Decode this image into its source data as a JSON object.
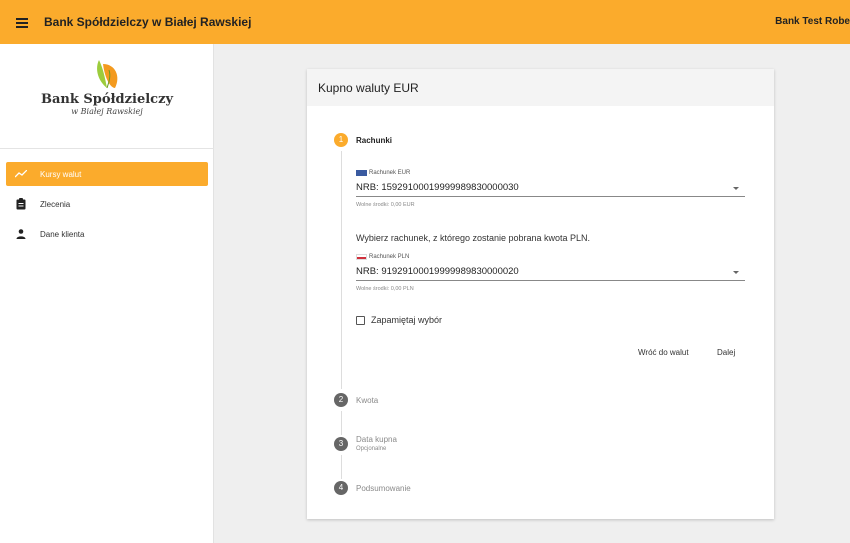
{
  "header": {
    "title": "Bank Spółdzielczy w Białej Rawskiej",
    "user": "Bank Test Robe"
  },
  "sidebar": {
    "logo_name": "Bank Spółdzielczy",
    "logo_sub": "w Białej Rawskiej",
    "items": [
      {
        "label": "Kursy walut",
        "icon": "trending-up-icon",
        "active": true
      },
      {
        "label": "Zlecenia",
        "icon": "clipboard-icon",
        "active": false
      },
      {
        "label": "Dane klienta",
        "icon": "person-icon",
        "active": false
      }
    ]
  },
  "card": {
    "title": "Kupno waluty EUR",
    "steps": [
      {
        "number": "1",
        "label": "Rachunki",
        "sub": ""
      },
      {
        "number": "2",
        "label": "Kwota",
        "sub": ""
      },
      {
        "number": "3",
        "label": "Data kupna",
        "sub": "Opcjonalne"
      },
      {
        "number": "4",
        "label": "Podsumowanie",
        "sub": ""
      }
    ],
    "eur_account": {
      "label": "Rachunek EUR",
      "value": "NRB: 15929100019999989830000030",
      "hint": "Wolne środki: 0,00 EUR"
    },
    "prompt": "Wybierz rachunek, z którego zostanie pobrana kwota PLN.",
    "pln_account": {
      "label": "Rachunek PLN",
      "value": "NRB: 91929100019999989830000020",
      "hint": "Wolne środki: 0,00 PLN"
    },
    "remember_label": "Zapamiętaj wybór",
    "remember_checked": false,
    "back_button": "Wróć do walut",
    "next_button": "Dalej"
  },
  "colors": {
    "accent": "#fbab2c",
    "step_inactive": "#666666"
  }
}
